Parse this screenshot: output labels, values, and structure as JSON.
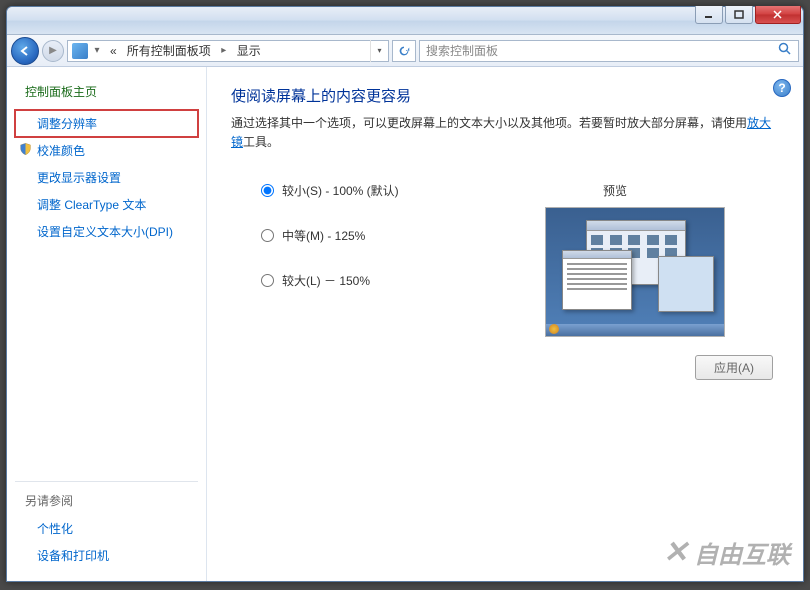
{
  "breadcrumb": {
    "prefix": "«",
    "items": [
      "所有控制面板项",
      "显示"
    ]
  },
  "search": {
    "placeholder": "搜索控制面板"
  },
  "sidebar": {
    "heading": "控制面板主页",
    "links": [
      {
        "label": "调整分辨率",
        "highlighted": true
      },
      {
        "label": "校准颜色",
        "icon": true
      },
      {
        "label": "更改显示器设置"
      },
      {
        "label": "调整 ClearType 文本"
      },
      {
        "label": "设置自定义文本大小(DPI)"
      }
    ],
    "see_also_heading": "另请参阅",
    "see_also": [
      "个性化",
      "设备和打印机"
    ]
  },
  "main": {
    "title": "使阅读屏幕上的内容更容易",
    "desc_before": "通过选择其中一个选项，可以更改屏幕上的文本大小以及其他项。若要暂时放大部分屏幕，请使用",
    "magnifier_link": "放大镜",
    "desc_after": "工具。",
    "options": [
      {
        "label": "较小(S) - 100% (默认)",
        "checked": true
      },
      {
        "label": "中等(M) - 125%",
        "checked": false
      },
      {
        "label": "较大(L) － 150%",
        "checked": false
      }
    ],
    "preview_label": "预览",
    "apply_label": "应用(A)"
  },
  "watermark": "自由互联"
}
